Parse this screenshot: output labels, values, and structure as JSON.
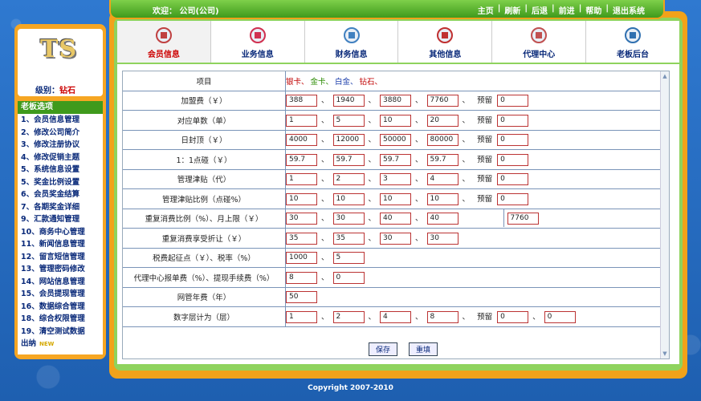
{
  "topbar": {
    "welcome": "欢迎： 公司(公司)",
    "nav": [
      "主页",
      "刷新",
      "后退",
      "前进",
      "帮助",
      "退出系统"
    ]
  },
  "left": {
    "logo": "TS",
    "level_label": "级别：",
    "level_value": "钻石",
    "menu_title": "老板选项",
    "menu": [
      "1、会员信息管理",
      "2、修改公司简介",
      "3、修改注册协议",
      "4、修改促销主题",
      "5、系统信息设置",
      "5、奖金比例设置",
      "6、会员奖金结算",
      "7、各期奖金详细",
      "9、汇款通知管理",
      "10、商务中心管理",
      "11、新闻信息管理",
      "12、留言短信管理",
      "13、管理密码修改",
      "14、网站信息管理",
      "15、会员提现管理",
      "16、数据综合管理",
      "18、综合权限管理",
      "19、清空测试数据",
      "出纳"
    ],
    "new_badge": "NEW"
  },
  "tabs": [
    {
      "label": "会员信息",
      "icon": "member-icon",
      "active": true
    },
    {
      "label": "业务信息",
      "icon": "business-icon"
    },
    {
      "label": "财务信息",
      "icon": "finance-icon"
    },
    {
      "label": "其他信息",
      "icon": "other-icon"
    },
    {
      "label": "代理中心",
      "icon": "agent-icon"
    },
    {
      "label": "老板后台",
      "icon": "boss-icon"
    }
  ],
  "form": {
    "header_label": "项目",
    "levels": [
      {
        "name": "银卡",
        "color": "#c00000"
      },
      {
        "name": "金卡",
        "color": "#2a8a00"
      },
      {
        "name": "白金",
        "color": "#1a3caa"
      },
      {
        "name": "钻石",
        "color": "#c00000"
      }
    ],
    "reserve": "预留",
    "dun": "、",
    "rows": [
      {
        "label": "加盟费（￥）",
        "values": [
          "388",
          "1940",
          "3880",
          "7760"
        ],
        "reserve": "0"
      },
      {
        "label": "对应单数（单）",
        "values": [
          "1",
          "5",
          "10",
          "20"
        ],
        "reserve": "0"
      },
      {
        "label": "日封顶（￥）",
        "values": [
          "4000",
          "12000",
          "50000",
          "80000"
        ],
        "reserve": "0"
      },
      {
        "label": "1：1点碰（￥）",
        "values": [
          "59.7",
          "59.7",
          "59.7",
          "59.7"
        ],
        "reserve": "0"
      },
      {
        "label": "管理津贴（代）",
        "values": [
          "1",
          "2",
          "3",
          "4"
        ],
        "reserve": "0"
      },
      {
        "label": "管理津贴比例（点碰%）",
        "values": [
          "10",
          "10",
          "10",
          "10"
        ],
        "reserve": "0"
      },
      {
        "label": "重复消费比例（%）、月上限（￥）",
        "values": [
          "30",
          "30",
          "40",
          "40"
        ],
        "extra": "7760"
      },
      {
        "label": "重复消费享受折让（￥）",
        "values": [
          "35",
          "35",
          "30",
          "30"
        ]
      },
      {
        "label": "税费起征点（￥）、税率（%）",
        "values": [
          "1000",
          "5"
        ]
      },
      {
        "label": "代理中心报单费（%）、提现手续费（%）",
        "values": [
          "8",
          "0"
        ]
      },
      {
        "label": "网管年费（年）",
        "values": [
          "50"
        ]
      },
      {
        "label": "数字层计为（层）",
        "values": [
          "1",
          "2",
          "4",
          "8"
        ],
        "reserve": "0",
        "reserve2": "0"
      }
    ],
    "save": "保存",
    "reset": "重填"
  },
  "copyright": "Copyright 2007-2010"
}
